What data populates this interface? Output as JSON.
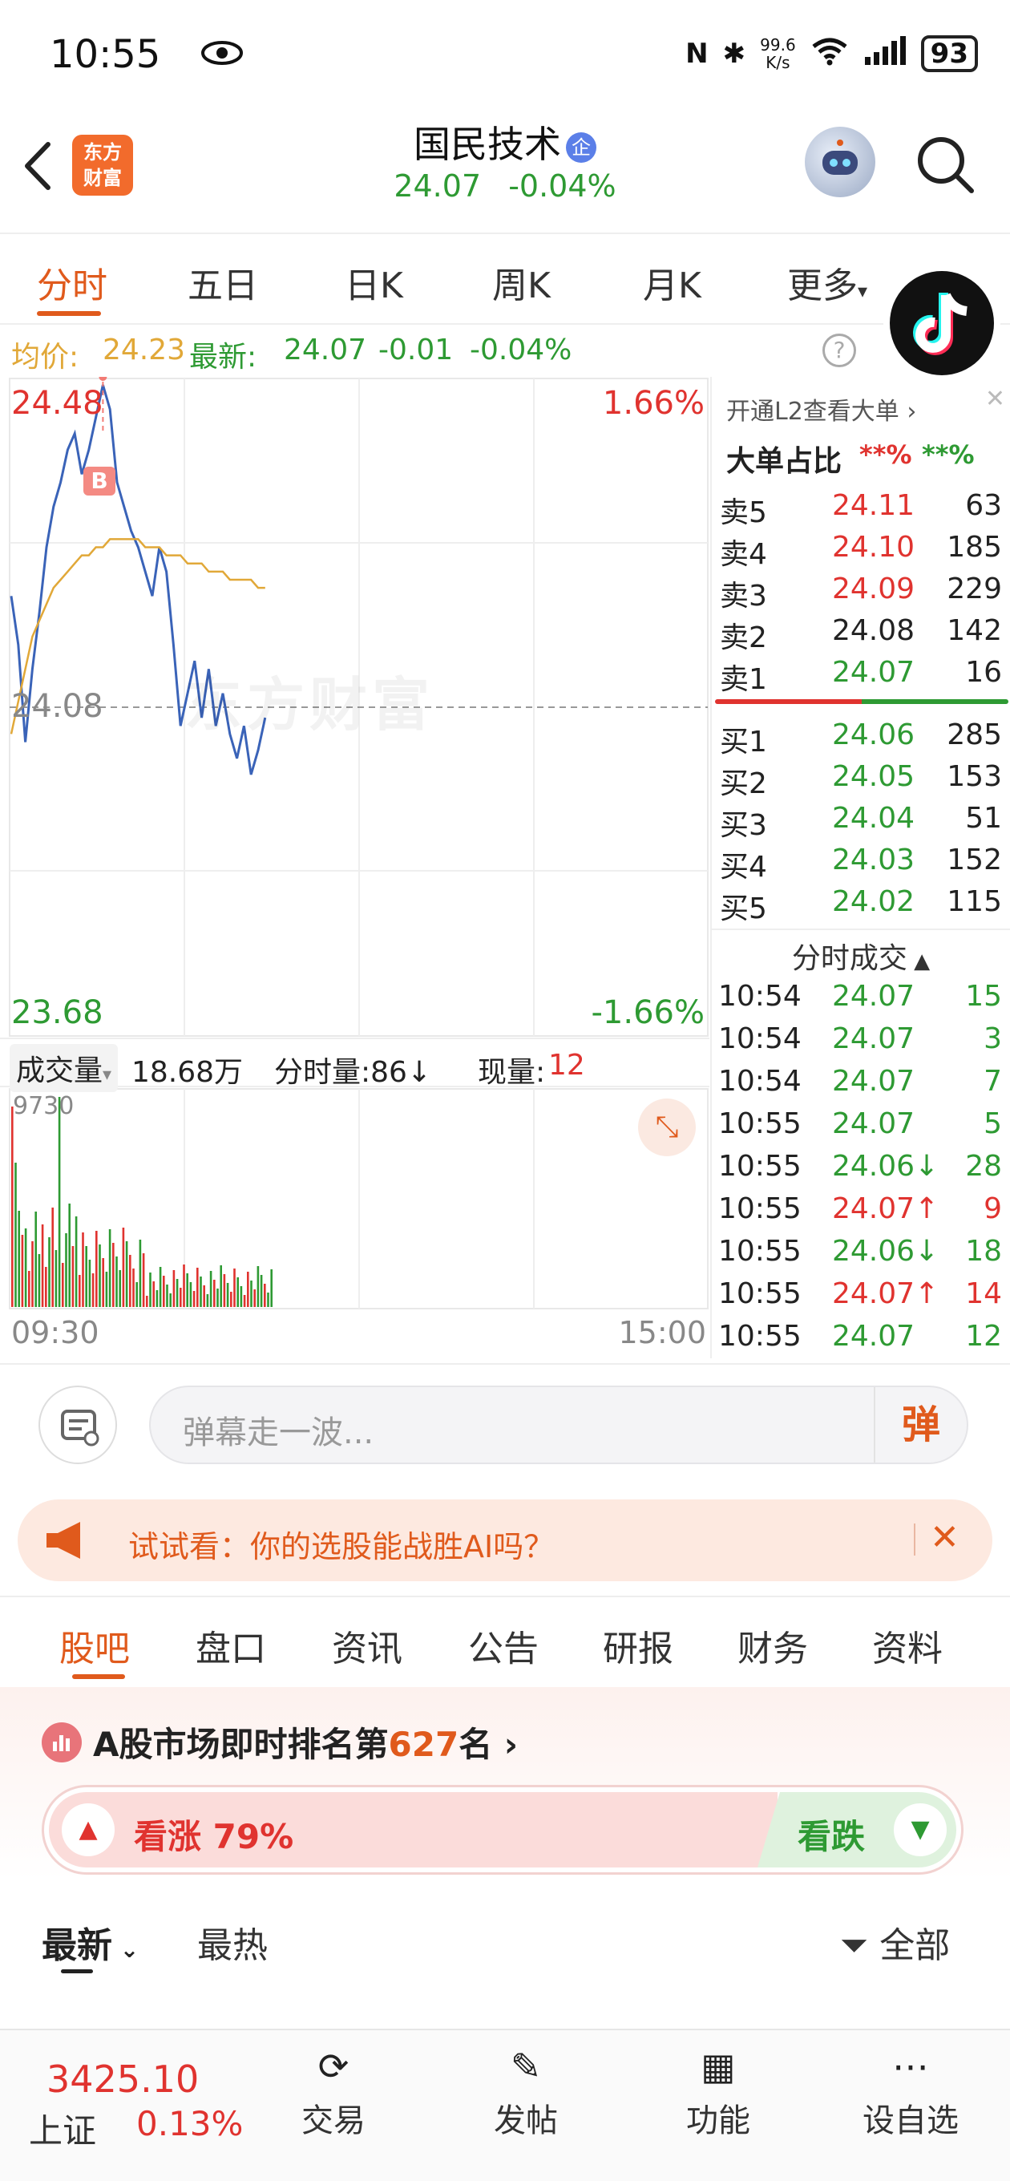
{
  "status_bar": {
    "time": "10:55",
    "net_speed_value": "99.6",
    "net_speed_unit": "K/s",
    "battery": "93"
  },
  "header": {
    "logo_line1": "东方",
    "logo_line2": "财富",
    "stock_name": "国民技术",
    "badge": "企",
    "price": "24.07",
    "change_pct": "-0.04%"
  },
  "chart_tabs": [
    "分时",
    "五日",
    "日K",
    "周K",
    "月K",
    "更多"
  ],
  "price_info": {
    "avg_label": "均价:",
    "avg_value": "24.23",
    "latest_label": "最新:",
    "latest_value": "24.07",
    "change": "-0.01",
    "change_pct": "-0.04%"
  },
  "chart": {
    "high_price": "24.48",
    "high_pct": "1.66%",
    "low_price": "23.68",
    "low_pct": "-1.66%",
    "prev_close": "24.08",
    "buy_marker": "B",
    "watermark": "东方财富",
    "time_start": "09:30",
    "time_end": "15:00",
    "vol_max": "9730"
  },
  "chart_data": {
    "type": "line",
    "title": "",
    "xlabel": "",
    "ylabel": "",
    "ylim": [
      23.68,
      24.48
    ],
    "series": [
      {
        "values": [
          24.22,
          24.16,
          24.04,
          24.13,
          24.2,
          24.28,
          24.33,
          24.36,
          24.4,
          24.42,
          24.37,
          24.4,
          24.44,
          24.48,
          24.45,
          24.36,
          24.33,
          24.3,
          24.28,
          24.25,
          24.22,
          24.28,
          24.25,
          24.16,
          24.06,
          24.1,
          24.14,
          24.07,
          24.13,
          24.06,
          24.1,
          24.05,
          24.02,
          24.06,
          24.0,
          24.03,
          24.07
        ]
      },
      {
        "values": [
          24.05,
          24.09,
          24.13,
          24.17,
          24.19,
          24.21,
          24.23,
          24.24,
          24.25,
          24.26,
          24.27,
          24.27,
          24.28,
          24.28,
          24.29,
          24.29,
          24.29,
          24.29,
          24.29,
          24.28,
          24.28,
          24.28,
          24.27,
          24.27,
          24.27,
          24.26,
          24.26,
          24.26,
          24.25,
          24.25,
          24.25,
          24.24,
          24.24,
          24.24,
          24.24,
          24.23,
          24.23
        ]
      }
    ]
  },
  "volume": {
    "label": "成交量",
    "total": "18.68万",
    "tick_label": "分时量:86↓",
    "now_label": "现量:",
    "now_value": "12"
  },
  "order_book": {
    "promo": "开通L2查看大单 ›",
    "big_label": "大单占比",
    "big_buy": "**%",
    "big_sell": "**%",
    "asks": [
      {
        "label": "卖5",
        "price": "24.11",
        "vol": "63"
      },
      {
        "label": "卖4",
        "price": "24.10",
        "vol": "185"
      },
      {
        "label": "卖3",
        "price": "24.09",
        "vol": "229"
      },
      {
        "label": "卖2",
        "price": "24.08",
        "vol": "142"
      },
      {
        "label": "卖1",
        "price": "24.07",
        "vol": "16"
      }
    ],
    "bids": [
      {
        "label": "买1",
        "price": "24.06",
        "vol": "285"
      },
      {
        "label": "买2",
        "price": "24.05",
        "vol": "153"
      },
      {
        "label": "买3",
        "price": "24.04",
        "vol": "51"
      },
      {
        "label": "买4",
        "price": "24.03",
        "vol": "152"
      },
      {
        "label": "买5",
        "price": "24.02",
        "vol": "115"
      }
    ],
    "trades_title": "分时成交",
    "trades": [
      {
        "time": "10:54",
        "price": "24.07",
        "vol": "15"
      },
      {
        "time": "10:54",
        "price": "24.07",
        "vol": "3"
      },
      {
        "time": "10:54",
        "price": "24.07",
        "vol": "7"
      },
      {
        "time": "10:55",
        "price": "24.07",
        "vol": "5"
      },
      {
        "time": "10:55",
        "price": "24.06↓",
        "vol": "28"
      },
      {
        "time": "10:55",
        "price": "24.07↑",
        "vol": "9"
      },
      {
        "time": "10:55",
        "price": "24.06↓",
        "vol": "18"
      },
      {
        "time": "10:55",
        "price": "24.07↑",
        "vol": "14"
      },
      {
        "time": "10:55",
        "price": "24.07",
        "vol": "12"
      }
    ]
  },
  "danmu": {
    "placeholder": "弹幕走一波...",
    "send_label": "弹"
  },
  "ai_banner": {
    "text": "试试看：你的选股能战胜AI吗？"
  },
  "info_tabs": [
    "股吧",
    "盘口",
    "资讯",
    "公告",
    "研报",
    "财务",
    "资料"
  ],
  "ranking": {
    "prefix": "A股市场即时排名第",
    "rank": "627",
    "suffix": "名 ›"
  },
  "sentiment": {
    "bull_label": "看涨 79%",
    "bear_label": "看跌",
    "bull_fraction": 0.79
  },
  "feed_filter": {
    "latest": "最新",
    "hottest": "最热",
    "all": "全部"
  },
  "bottom_nav": {
    "index_value": "3425.10",
    "index_name": "上证",
    "index_pct": "0.13%",
    "trade": "交易",
    "post": "发帖",
    "func": "功能",
    "watchlist": "设自选"
  },
  "colors": {
    "up": "#e0332f",
    "down": "#2e9a33",
    "accent": "#e05a1c",
    "avg_line": "#e1a838",
    "price_line": "#3a63b8"
  }
}
